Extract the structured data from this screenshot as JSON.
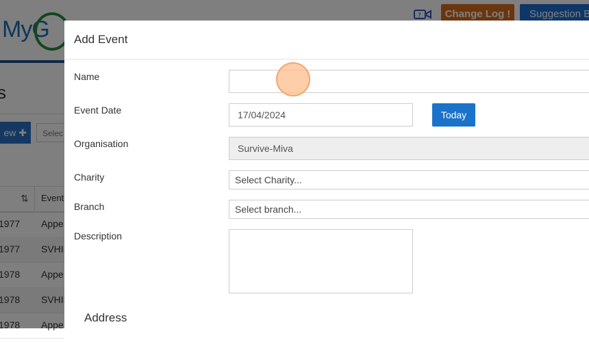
{
  "app": {
    "logo_text": "MyG",
    "header_buttons": {
      "change_log": "Change Log",
      "suggestion": "Suggestion Bo"
    },
    "page_heading": "s",
    "new_button": "ew",
    "filter_select": "Selec",
    "table": {
      "columns": [
        "",
        "Event"
      ],
      "rows": [
        {
          "year": "1977",
          "event": "Appe"
        },
        {
          "year": "1977",
          "event": "SVHIS"
        },
        {
          "year": "1978",
          "event": "Appe"
        },
        {
          "year": "1978",
          "event": "SVHIS"
        },
        {
          "year": "1978",
          "event": "Appe"
        }
      ]
    }
  },
  "modal": {
    "title": "Add Event",
    "fields": {
      "name": {
        "label": "Name",
        "value": ""
      },
      "event_date": {
        "label": "Event Date",
        "value": "17/04/2024",
        "today_button": "Today"
      },
      "organisation": {
        "label": "Organisation",
        "value": "Survive-Miva"
      },
      "charity": {
        "label": "Charity",
        "placeholder": "Select Charity..."
      },
      "branch": {
        "label": "Branch",
        "placeholder": "Select branch..."
      },
      "description": {
        "label": "Description",
        "value": ""
      }
    },
    "address_heading": "Address"
  },
  "colors": {
    "change_log_button": "#d76a1a",
    "suggestion_button": "#1d6fcf",
    "today_button": "#1a73c9",
    "logo_blue": "#1d6fb8",
    "logo_green": "#2a8c3c"
  },
  "icons": {
    "camera": "video-camera-icon",
    "sort": "sort-icon",
    "plus": "plus-icon"
  }
}
